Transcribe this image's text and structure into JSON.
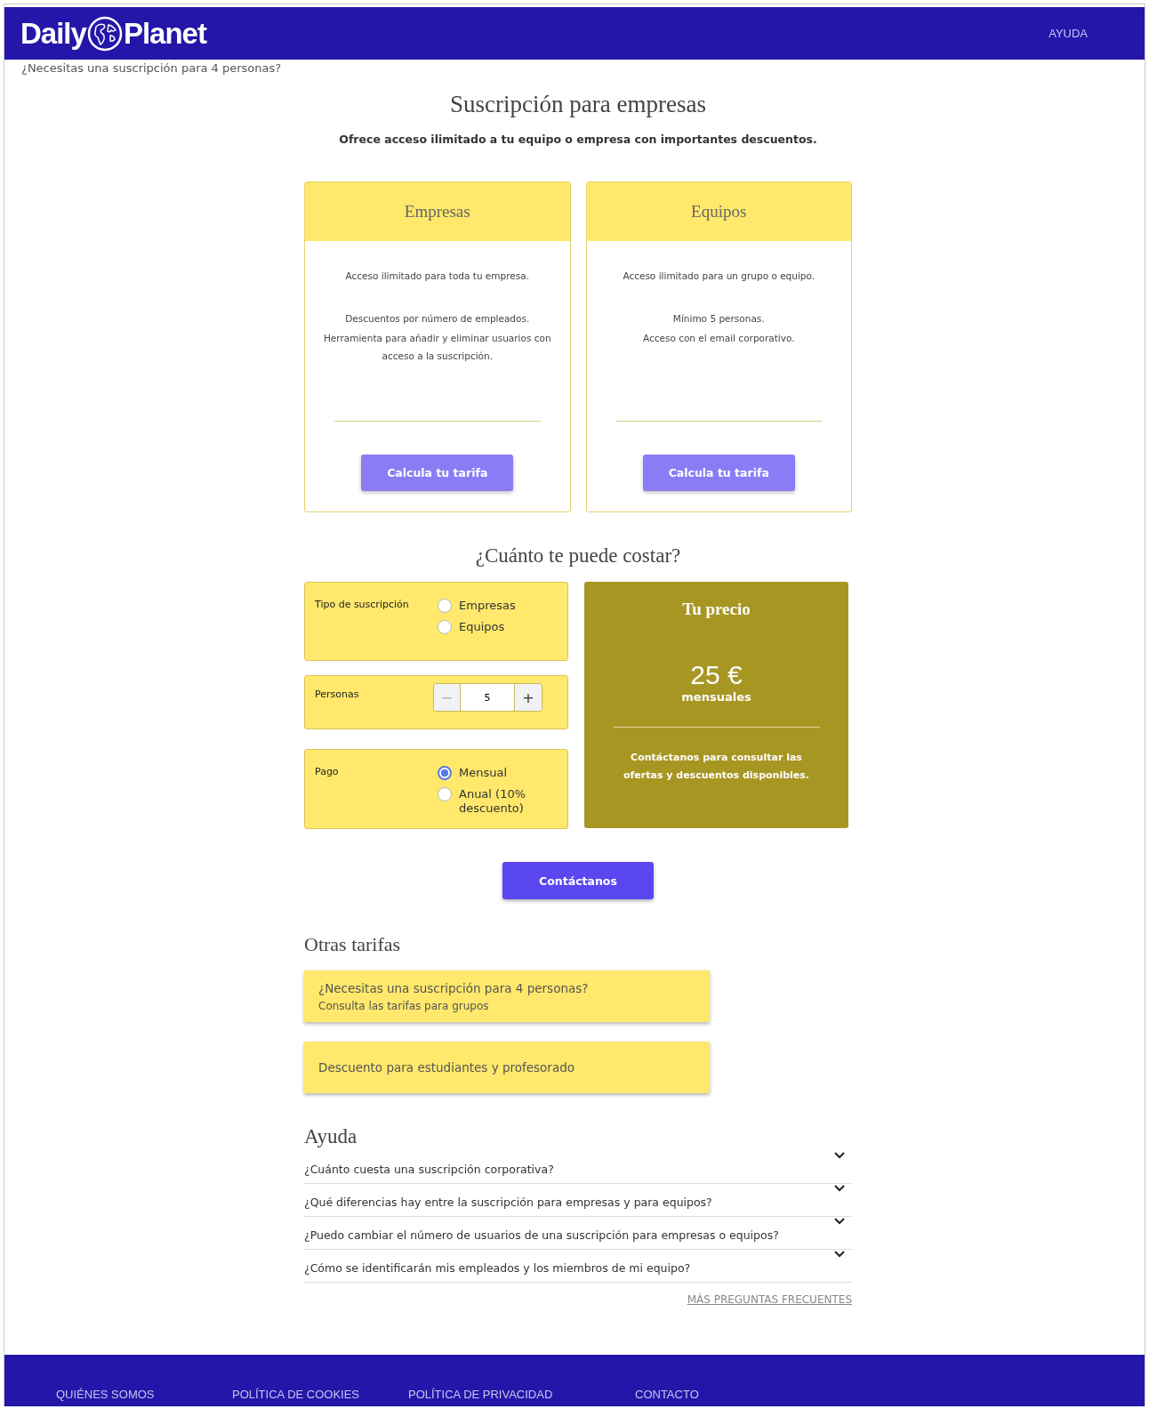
{
  "header": {
    "logo_left": "Daily",
    "logo_right": "Planet",
    "help_link": "AYUDA"
  },
  "notice": "¿Necesitas una suscripción para 4 personas?",
  "title": "Suscripción para empresas",
  "intro": "Ofrece acceso ilimitado a tu equipo o empresa con importantes descuentos.",
  "plans": [
    {
      "name": "Empresas",
      "features": [
        "Acceso ilimitado para toda tu empresa.",
        "Descuentos por número de empleados.",
        "Herramienta para añadir y eliminar usuarios con acceso a la suscripción."
      ],
      "button": "Calcula tu tarifa"
    },
    {
      "name": "Equipos",
      "features": [
        "Acceso ilimitado para un grupo o equipo.",
        "Mínimo 5 personas.",
        "Acceso con el email corporativo."
      ],
      "button": "Calcula tu tarifa"
    }
  ],
  "calculator": {
    "title": "¿Cuánto te puede costar?",
    "type": {
      "label": "Tipo de suscripción",
      "options": [
        {
          "label": "Empresas",
          "selected": false
        },
        {
          "label": "Equipos",
          "selected": false
        }
      ]
    },
    "people": {
      "label": "Personas",
      "minus": "−",
      "value": "5",
      "plus": "+"
    },
    "payment": {
      "label": "Pago",
      "options": [
        {
          "label": "Mensual",
          "selected": true
        },
        {
          "label": "Anual (10% descuento)",
          "selected": false
        }
      ]
    },
    "price": {
      "title": "Tu precio",
      "amount": "25 €",
      "period": "mensuales",
      "note": "Contáctanos para consultar las ofertas y descuentos disponibles."
    },
    "contact_button": "Contáctanos"
  },
  "other_rates": {
    "title": "Otras tarifas",
    "items": [
      {
        "title": "¿Necesitas una suscripción para 4 personas?",
        "subtitle": "Consulta las tarifas para grupos"
      },
      {
        "title": "Descuento para estudiantes y profesorado"
      }
    ]
  },
  "help": {
    "title": "Ayuda",
    "questions": [
      {
        "text": "¿Cuánto cuesta una suscripción corporativa?",
        "expanded": false
      },
      {
        "text": "¿Qué diferencias hay entre la suscripción para empresas y para equipos?",
        "expanded": false
      },
      {
        "text": "¿Puedo cambiar el número de usuarios de una suscripción para empresas o equipos?",
        "expanded": false
      },
      {
        "text": "¿Cómo se identificarán mis empleados y los miembros de mi equipo?",
        "expanded": false
      }
    ],
    "more_link": "MÁS PREGUNTAS FRECUENTES"
  },
  "footer": [
    "QUIÉNES SOMOS",
    "POLÍTICA DE COOKIES",
    "POLÍTICA DE PRIVACIDAD",
    "CONTACTO"
  ]
}
